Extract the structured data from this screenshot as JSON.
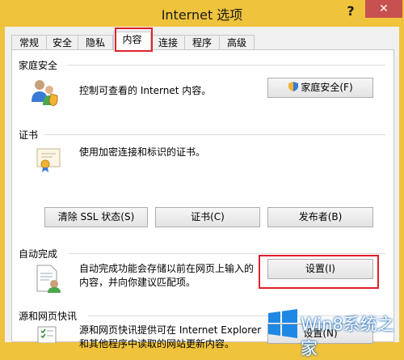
{
  "window": {
    "title": "Internet 选项",
    "help": "?",
    "close": "✕"
  },
  "tabs": [
    {
      "label": "常规"
    },
    {
      "label": "安全"
    },
    {
      "label": "隐私"
    },
    {
      "label": "内容",
      "active": true
    },
    {
      "label": "连接"
    },
    {
      "label": "程序"
    },
    {
      "label": "高级"
    }
  ],
  "family_safety": {
    "title": "家庭安全",
    "description": "控制可查看的 Internet 内容。",
    "button_label": "家庭安全(F)"
  },
  "certificates": {
    "title": "证书",
    "description": "使用加密连接和标识的证书。",
    "buttons": [
      "清除 SSL 状态(S)",
      "证书(C)",
      "发布者(B)"
    ]
  },
  "autocomplete": {
    "title": "自动完成",
    "description_line1": "自动完成功能会存储以前在网页上输入的",
    "description_line2": "内容，并向你建议匹配项。",
    "button_label": "设置(I)"
  },
  "feeds": {
    "title": "源和网页快讯",
    "description_line1": "源和网页快讯提供可在 Internet Explorer",
    "description_line2": "和其他程序中读取的网站更新内容。",
    "button_label": "设置(N)"
  },
  "watermark": {
    "text": "Win8系统之家"
  },
  "colors": {
    "titlebar": "#f0c33c",
    "close": "#c75050",
    "highlight": "#e0202a"
  }
}
